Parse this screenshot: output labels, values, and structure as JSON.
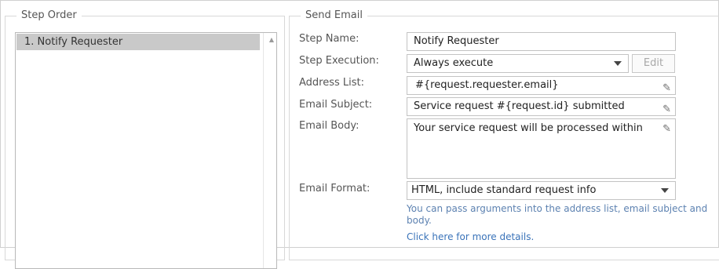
{
  "step_order": {
    "legend": "Step Order",
    "items": [
      {
        "label": "1. Notify Requester"
      }
    ]
  },
  "send_email": {
    "legend": "Send Email",
    "labels": {
      "step_name": "Step Name:",
      "step_execution": "Step Execution:",
      "address_list": "Address List:",
      "email_subject": "Email Subject:",
      "email_body": "Email Body:",
      "email_format": "Email Format:"
    },
    "values": {
      "step_name": "Notify Requester",
      "step_execution": "Always execute",
      "address_list": "#{request.requester.email}",
      "email_subject": "Service request #{request.id} submitted",
      "email_body": "Your service request will be processed within",
      "email_format": "HTML, include standard request info"
    },
    "edit_label": "Edit",
    "help_text": "You can pass arguments into the address list, email subject and body.",
    "details_link": "Click here for more details."
  },
  "icons": {
    "pencil": "pencil-icon",
    "dropdown": "chevron-down-icon",
    "scroll_up": "scroll-up-arrow"
  }
}
